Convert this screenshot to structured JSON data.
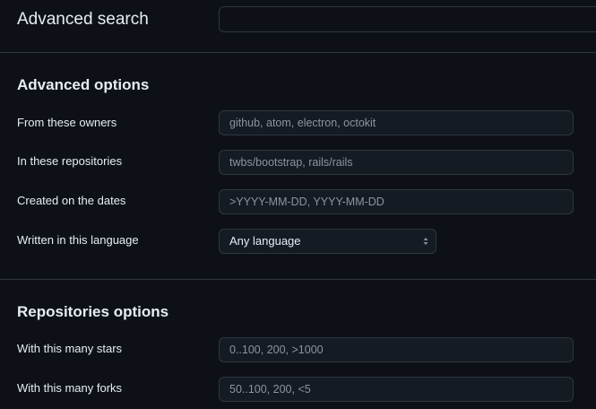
{
  "header": {
    "title": "Advanced search",
    "search_value": ""
  },
  "advanced_options": {
    "title": "Advanced options",
    "owners_label": "From these owners",
    "owners_placeholder": "github, atom, electron, octokit",
    "repos_label": "In these repositories",
    "repos_placeholder": "twbs/bootstrap, rails/rails",
    "dates_label": "Created on the dates",
    "dates_placeholder": ">YYYY-MM-DD, YYYY-MM-DD",
    "language_label": "Written in this language",
    "language_selected": "Any language"
  },
  "repositories_options": {
    "title": "Repositories options",
    "stars_label": "With this many stars",
    "stars_placeholder": "0..100, 200, >1000",
    "forks_label": "With this many forks",
    "forks_placeholder": "50..100, 200, <5"
  },
  "icons": {
    "select_arrows": "chevron-up-down-icon"
  },
  "colors": {
    "background": "#0d1117",
    "input_background": "#151b23",
    "border": "#30363d",
    "text": "#e6edf3",
    "placeholder": "#8b949e"
  }
}
